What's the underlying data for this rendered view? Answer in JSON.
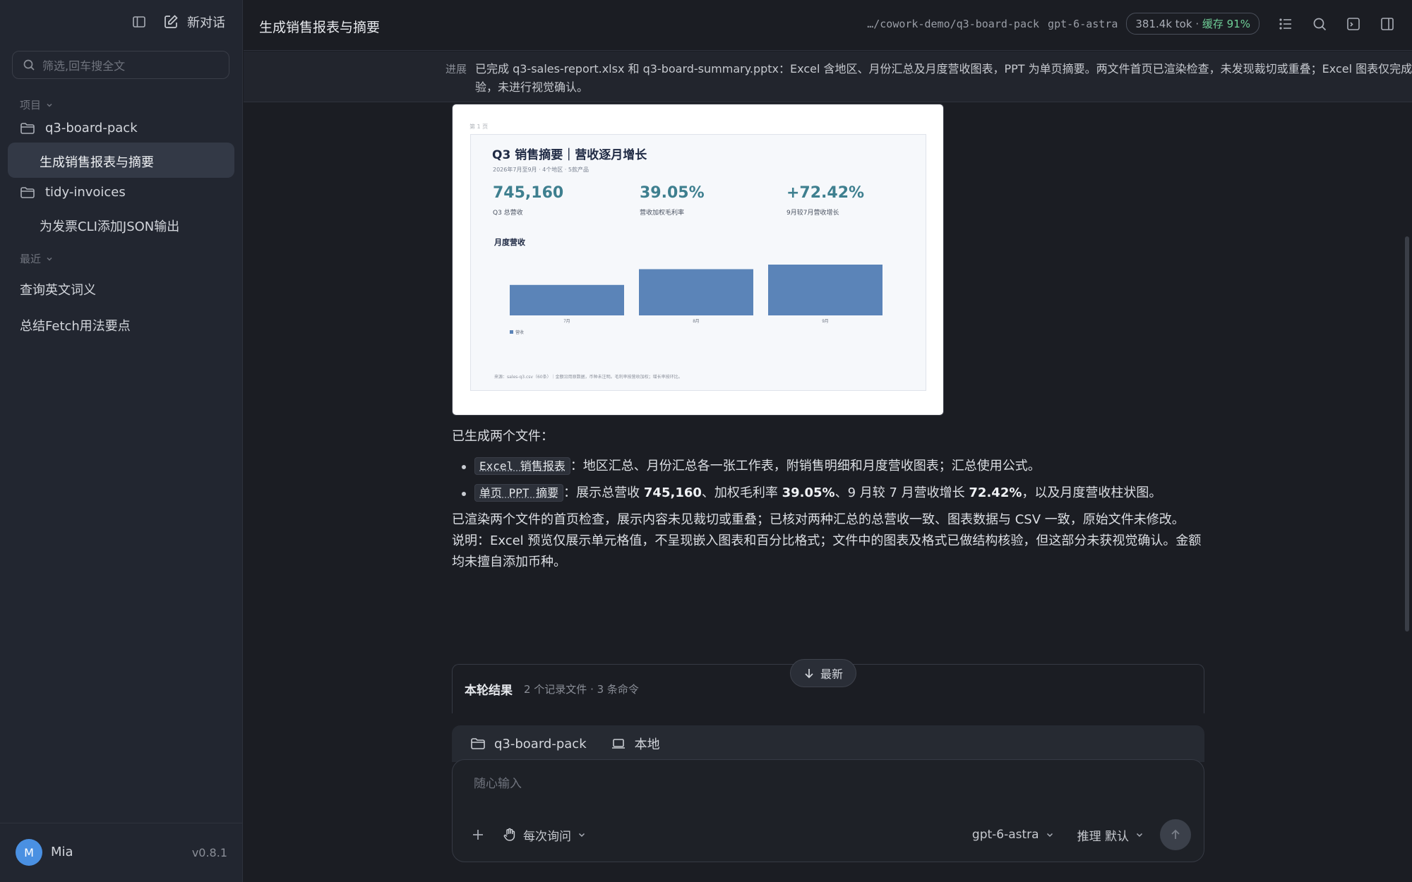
{
  "sidebar": {
    "new_chat_label": "新对话",
    "filter_placeholder": "筛选,回车搜全文",
    "section_projects": "项目",
    "projects": [
      {
        "name": "q3-board-pack",
        "conversations": [
          "生成销售报表与摘要"
        ]
      },
      {
        "name": "tidy-invoices",
        "conversations": [
          "为发票CLI添加JSON输出"
        ]
      }
    ],
    "section_recent": "最近",
    "recent": [
      "查询英文词义",
      "总结Fetch用法要点"
    ],
    "user": {
      "initial": "M",
      "name": "Mia",
      "version": "v0.8.1"
    }
  },
  "header": {
    "title": "生成销售报表与摘要",
    "path": "…/cowork-demo/q3-board-pack",
    "model": "gpt-6-astra",
    "tokens": "381.4k tok",
    "separator": "·",
    "cache": "缓存 91%"
  },
  "progress": {
    "label": "进展",
    "text": "已完成 q3-sales-report.xlsx 和 q3-board-summary.pptx：Excel 含地区、月份汇总及月度营收图表，PPT 为单页摘要。两文件首页已渲染检查，未发现裁切或重叠；Excel 图表仅完成结构核验，未进行视觉确认。"
  },
  "preview": {
    "page_label": "第 1 页",
    "title": "Q3 销售摘要｜营收逐月增长",
    "subtitle": "2026年7月至9月 · 4个地区 · 5款产品",
    "kpis": [
      {
        "value": "745,160",
        "label": "Q3 总营收"
      },
      {
        "value": "39.05%",
        "label": "营收加权毛利率"
      },
      {
        "value": "+72.42%",
        "label": "9月较7月营收增长"
      }
    ],
    "chart_title": "月度营收",
    "legend": "营收",
    "note": "来源：sales-q3.csv（60条）｜金额沿用原数据，币种未注明。毛利率按营收加权；增长率按环比。",
    "bar_color": "#5b84b8"
  },
  "chart_data": {
    "type": "bar",
    "title": "月度营收",
    "categories": [
      "7月",
      "8月",
      "9月"
    ],
    "series": [
      {
        "name": "营收",
        "values": [
          0.6,
          0.91,
          1.0
        ]
      }
    ],
    "legend": "bottom-left",
    "grid": false
  },
  "message": {
    "intro": "已生成两个文件：",
    "items": [
      {
        "chip": "Excel 销售报表",
        "text_before": "：地区汇总、月份汇总各一张工作表，附销售明细和月度营收图表；汇总使用公式。"
      },
      {
        "chip": "单页 PPT 摘要",
        "t1": "：展示总营收 ",
        "b1": "745,160",
        "t2": "、加权毛利率 ",
        "b2": "39.05%",
        "t3": "、9 月较 7 月营收增长 ",
        "b3": "72.42%",
        "t4": "，以及月度营收柱状图。"
      }
    ],
    "p2": "已渲染两个文件的首页检查，展示内容未见裁切或重叠；已核对两种汇总的总营收一致、图表数据与 CSV 一致，原始文件未修改。",
    "p3": "说明：Excel 预览仅展示单元格值，不呈现嵌入图表和百分比格式；文件中的图表及格式已做结构核验，但这部分未获视觉确认。金额均未擅自添加币种。"
  },
  "turn": {
    "title": "本轮结果",
    "meta": "2 个记录文件 · 3 条命令"
  },
  "latest_label": "最新",
  "composer": {
    "project": "q3-board-pack",
    "env": "本地",
    "placeholder": "随心输入",
    "approval": "每次询问",
    "model": "gpt-6-astra",
    "reasoning": "推理 默认"
  }
}
